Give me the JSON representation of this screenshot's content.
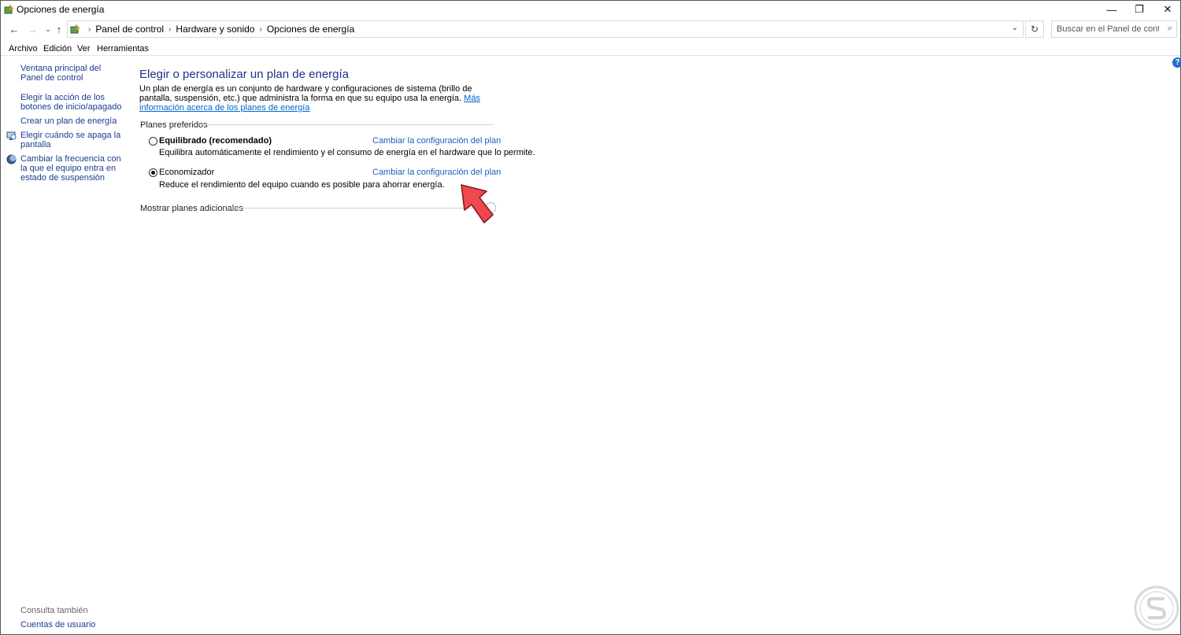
{
  "window": {
    "title": "Opciones de energía",
    "controls": {
      "minimize": "—",
      "restore": "❐",
      "close": "✕"
    }
  },
  "nav": {
    "breadcrumbs": [
      "Panel de control",
      "Hardware y sonido",
      "Opciones de energía"
    ],
    "search_placeholder": "Buscar en el Panel de control"
  },
  "menu": [
    "Archivo",
    "Edición",
    "Ver",
    "Herramientas"
  ],
  "sidebar": {
    "links": [
      {
        "label": "Ventana principal del Panel de control",
        "icon": ""
      },
      {
        "label": "Elegir la acción de los botones de inicio/apagado",
        "icon": ""
      },
      {
        "label": "Crear un plan de energía",
        "icon": ""
      },
      {
        "label": "Elegir cuándo se apaga la pantalla",
        "icon": "monitor-power-icon"
      },
      {
        "label": "Cambiar la frecuencia con la que el equipo entra en estado de suspensión",
        "icon": "moon-icon"
      }
    ],
    "see_also_label": "Consulta también",
    "see_also_links": [
      "Cuentas de usuario"
    ]
  },
  "main": {
    "title": "Elegir o personalizar un plan de energía",
    "intro_text": "Un plan de energía es un conjunto de hardware y configuraciones de sistema (brillo de pantalla, suspensión, etc.) que administra la forma en que su equipo usa la energía.",
    "intro_link": "Más información acerca de los planes de energía",
    "preferred_label": "Planes preferidos",
    "plans": [
      {
        "name": "Equilibrado (recomendado)",
        "description": "Equilibra automáticamente el rendimiento y el consumo de energía en el hardware que lo permite.",
        "link": "Cambiar la configuración del plan",
        "selected": false
      },
      {
        "name": "Economizador",
        "description": "Reduce el rendimiento del equipo cuando es posible para ahorrar energía.",
        "link": "Cambiar la configuración del plan",
        "selected": true
      }
    ],
    "more_plans_label": "Mostrar planes adicionales"
  },
  "colors": {
    "title_blue": "#1e3287",
    "link_blue": "#1f5fb8",
    "arrow_red": "#f0484f"
  }
}
